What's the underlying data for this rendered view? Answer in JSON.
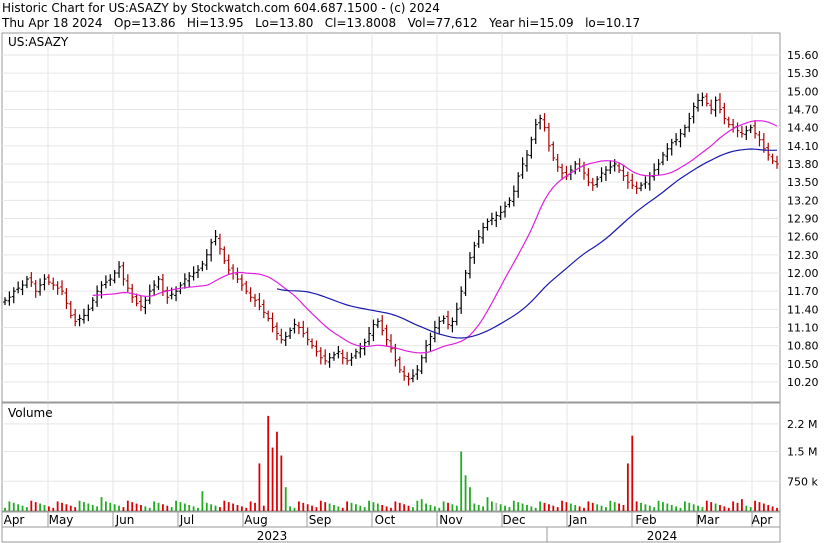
{
  "header": {
    "title_line": "Historic Chart for US:ASAZY by Stockwatch.com 604.687.1500 - (c) 2024",
    "stats_line": "Thu Apr 18 2024   Op=13.86   Hi=13.95   Lo=13.80   Cl=13.8008   Vol=77,612   Year hi=15.09   lo=10.17"
  },
  "colors": {
    "up_bar": "#000000",
    "down_bar": "#aa0000",
    "ma_short": "#e020e0",
    "ma_long": "#1a1aaa",
    "vol_up": "#22aa22",
    "vol_down": "#dd0000",
    "vol_neutral": "#aaaaaa",
    "grid": "#e6e6e6",
    "frame": "#999999"
  },
  "chart_data": [
    {
      "type": "candlestick",
      "label": "US:ASAZY",
      "ylim": [
        10.0,
        15.75
      ],
      "y_ticks": [
        10.2,
        10.5,
        10.8,
        11.1,
        11.4,
        11.7,
        12.0,
        12.3,
        12.6,
        12.9,
        13.2,
        13.5,
        13.8,
        14.1,
        14.4,
        14.7,
        15.0,
        15.3,
        15.6
      ],
      "y_tick_labels": [
        "10.20",
        "10.50",
        "10.80",
        "11.10",
        "11.40",
        "11.70",
        "12.00",
        "12.30",
        "12.60",
        "12.90",
        "13.20",
        "13.50",
        "13.80",
        "14.10",
        "14.40",
        "14.70",
        "15.00",
        "15.30",
        "15.60"
      ],
      "grid": true,
      "x_months": [
        "Apr",
        "May",
        "Jun",
        "Jul",
        "Aug",
        "Sep",
        "Oct",
        "Nov",
        "Dec",
        "Jan",
        "Feb",
        "Mar",
        "Apr"
      ],
      "x_years": [
        "2023",
        "2024"
      ],
      "closes": [
        11.55,
        11.6,
        11.7,
        11.75,
        11.8,
        11.9,
        11.85,
        11.7,
        11.8,
        11.9,
        11.85,
        11.8,
        11.75,
        11.7,
        11.5,
        11.3,
        11.2,
        11.25,
        11.3,
        11.4,
        11.55,
        11.7,
        11.8,
        11.85,
        11.9,
        12.0,
        12.1,
        11.9,
        11.75,
        11.6,
        11.5,
        11.45,
        11.55,
        11.7,
        11.8,
        11.9,
        11.7,
        11.6,
        11.65,
        11.7,
        11.8,
        11.9,
        11.95,
        12.0,
        12.05,
        12.15,
        12.3,
        12.5,
        12.6,
        12.4,
        12.2,
        12.05,
        12.0,
        11.9,
        11.8,
        11.7,
        11.6,
        11.55,
        11.45,
        11.35,
        11.25,
        11.1,
        11.0,
        10.9,
        10.95,
        11.05,
        11.15,
        11.1,
        11.0,
        10.9,
        10.8,
        10.7,
        10.6,
        10.55,
        10.6,
        10.65,
        10.7,
        10.6,
        10.55,
        10.6,
        10.7,
        10.75,
        10.85,
        11.0,
        11.15,
        11.2,
        11.05,
        10.9,
        10.75,
        10.55,
        10.4,
        10.3,
        10.25,
        10.3,
        10.4,
        10.6,
        10.8,
        10.95,
        11.1,
        11.2,
        11.25,
        11.15,
        11.2,
        11.4,
        11.7,
        12.0,
        12.25,
        12.45,
        12.6,
        12.75,
        12.85,
        12.9,
        12.95,
        13.0,
        13.1,
        13.2,
        13.35,
        13.6,
        13.8,
        13.95,
        14.2,
        14.45,
        14.55,
        14.4,
        14.1,
        13.9,
        13.75,
        13.65,
        13.6,
        13.7,
        13.8,
        13.75,
        13.65,
        13.5,
        13.45,
        13.55,
        13.65,
        13.7,
        13.75,
        13.8,
        13.7,
        13.6,
        13.5,
        13.45,
        13.4,
        13.45,
        13.5,
        13.6,
        13.7,
        13.8,
        13.95,
        14.05,
        14.15,
        14.2,
        14.3,
        14.4,
        14.55,
        14.75,
        14.85,
        14.9,
        14.8,
        14.7,
        14.85,
        14.7,
        14.55,
        14.45,
        14.4,
        14.35,
        14.3,
        14.35,
        14.4,
        14.3,
        14.2,
        14.05,
        13.95,
        13.85,
        13.8
      ],
      "ma_short_label": "short moving average (magenta)",
      "ma_long_label": "long moving average (blue)"
    },
    {
      "type": "bar",
      "label": "Volume",
      "y_ticks": [
        750000,
        1500000,
        2200000
      ],
      "y_tick_labels": [
        "750 k",
        "1.5 M",
        "2.2 M"
      ],
      "ylim": [
        0,
        2700000
      ]
    }
  ]
}
